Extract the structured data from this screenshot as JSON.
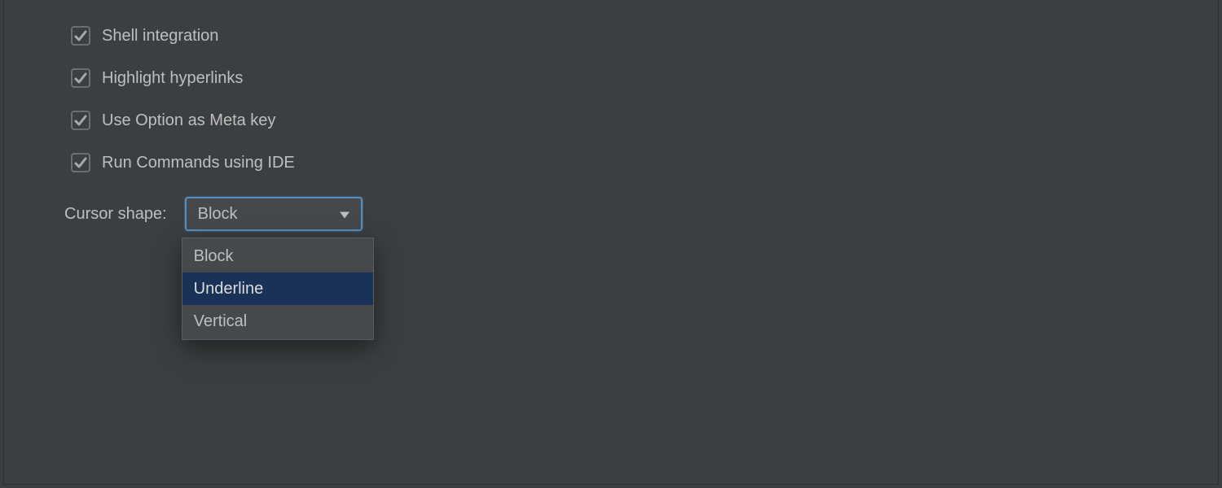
{
  "checkboxes": [
    {
      "label": "Shell integration",
      "checked": true
    },
    {
      "label": "Highlight hyperlinks",
      "checked": true
    },
    {
      "label": "Use Option as Meta key",
      "checked": true
    },
    {
      "label": "Run Commands using IDE",
      "checked": true
    }
  ],
  "cursor_shape": {
    "label": "Cursor shape:",
    "selected": "Block",
    "options": [
      "Block",
      "Underline",
      "Vertical"
    ],
    "highlighted_index": 1
  }
}
